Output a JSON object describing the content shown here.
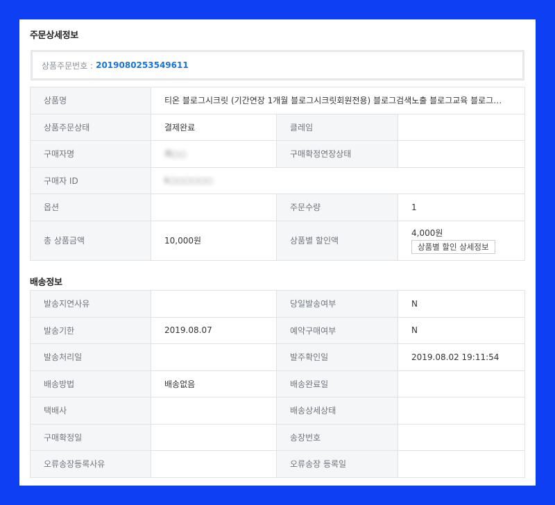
{
  "order_detail": {
    "title": "주문상세정보",
    "order_number_label": "상품주문번호 :",
    "order_number": "2019080253549611",
    "rows": {
      "product_name_label": "상품명",
      "product_name": "티온 블로그시크릿 (기간연장 1개월 블로그시크릿회원전용) 블로그검색노출 블로그교육 블로그…",
      "status_label": "상품주문상태",
      "status": "결제완료",
      "claim_label": "클레임",
      "claim": "",
      "buyer_name_label": "구매자명",
      "buyer_name": "최○○",
      "confirm_ext_label": "구매확정연장상태",
      "confirm_ext": "",
      "buyer_id_label": "구매자 ID",
      "buyer_id": "k○○○○○○",
      "option_label": "옵션",
      "option": "",
      "quantity_label": "주문수량",
      "quantity": "1",
      "total_price_label": "총 상품금액",
      "total_price": "10,000원",
      "discount_label": "상품별 할인액",
      "discount": "4,000원",
      "discount_detail_button": "상품별 할인 상세정보"
    }
  },
  "shipping": {
    "title": "배송정보",
    "rows": {
      "delay_reason_label": "발송지연사유",
      "delay_reason": "",
      "same_day_label": "당일발송여부",
      "same_day": "N",
      "deadline_label": "발송기한",
      "deadline": "2019.08.07",
      "reservation_label": "예약구매여부",
      "reservation": "N",
      "processed_label": "발송처리일",
      "processed": "",
      "order_confirmed_label": "발주확인일",
      "order_confirmed": "2019.08.02 19:11:54",
      "method_label": "배송방법",
      "method": "배송없음",
      "completed_label": "배송완료일",
      "completed": "",
      "courier_label": "택배사",
      "courier": "",
      "detail_status_label": "배송상세상태",
      "detail_status": "",
      "purchase_confirmed_label": "구매확정일",
      "purchase_confirmed": "",
      "tracking_label": "송장번호",
      "tracking": "",
      "error_reason_label": "오류송장등록사유",
      "error_reason": "",
      "error_date_label": "오류송장 등록일",
      "error_date": ""
    }
  }
}
